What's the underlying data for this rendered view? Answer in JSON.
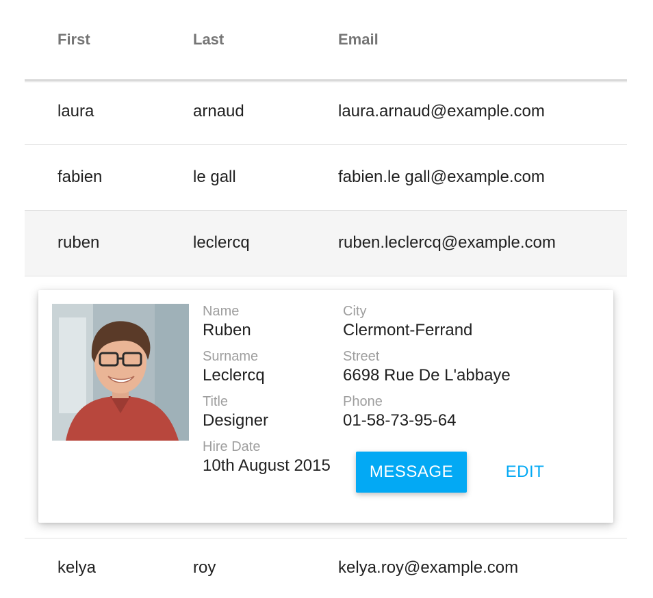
{
  "table": {
    "columns": {
      "first": "First",
      "last": "Last",
      "email": "Email"
    },
    "rows": [
      {
        "first": "laura",
        "last": "arnaud",
        "email": "laura.arnaud@example.com"
      },
      {
        "first": "fabien",
        "last": "le gall",
        "email": "fabien.le gall@example.com"
      },
      {
        "first": "ruben",
        "last": "leclercq",
        "email": "ruben.leclercq@example.com"
      },
      {
        "first": "kelya",
        "last": "roy",
        "email": "kelya.roy@example.com"
      }
    ]
  },
  "detail": {
    "name_label": "Name",
    "name": "Ruben",
    "surname_label": "Surname",
    "surname": "Leclercq",
    "title_label": "Title",
    "title": "Designer",
    "hire_label": "Hire Date",
    "hire_date": "10th August 2015",
    "city_label": "City",
    "city": "Clermont-Ferrand",
    "street_label": "Street",
    "street": "6698 Rue De L'abbaye",
    "phone_label": "Phone",
    "phone": "01-58-73-95-64",
    "message_button": "MESSAGE",
    "edit_button": "EDIT"
  },
  "colors": {
    "accent": "#03a9f4",
    "selected_row": "#f5f5f5"
  }
}
